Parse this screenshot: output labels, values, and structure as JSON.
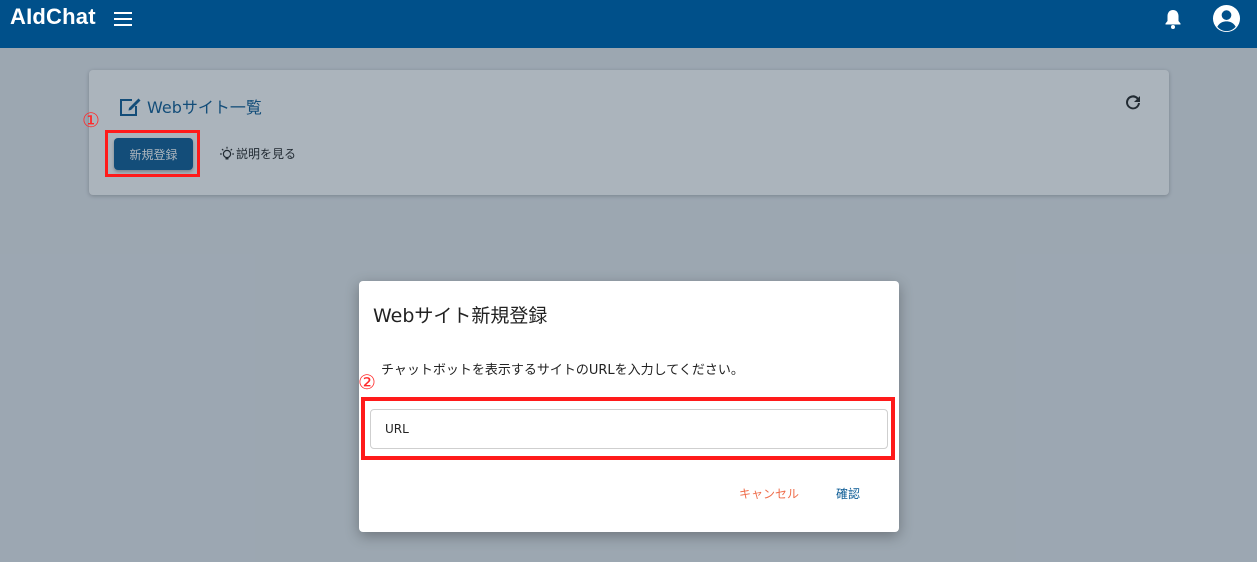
{
  "app": {
    "brand": "AIdChat",
    "icons": {
      "menu": "menu-icon",
      "bell": "bell-icon",
      "account": "account-circle-icon"
    }
  },
  "card": {
    "title": "Webサイト一覧",
    "new_button": "新規登録",
    "help_link": "説明を見る"
  },
  "dialog": {
    "title": "Webサイト新規登録",
    "description": "チャットボットを表示するサイトのURLを入力してください。",
    "url_placeholder": "URL",
    "cancel_label": "キャンセル",
    "confirm_label": "確認"
  },
  "annotations": {
    "marker_1": "①",
    "marker_2": "②"
  },
  "colors": {
    "topbar": "#00508a",
    "primary": "#0a5a94",
    "cancel": "#ef6e4c",
    "annotation": "#ff1a1a"
  }
}
